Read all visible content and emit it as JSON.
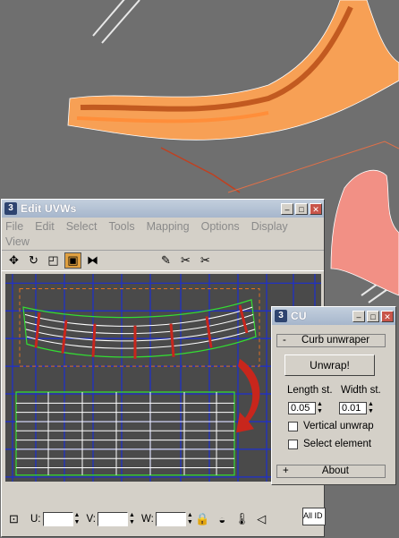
{
  "edit_uvws": {
    "title": "Edit UVWs",
    "menu": [
      "File",
      "Edit",
      "Select",
      "Tools",
      "Mapping",
      "Options",
      "Display",
      "View"
    ],
    "status": {
      "u_label": "U:",
      "v_label": "V:",
      "w_label": "W:",
      "u_value": "",
      "v_value": "",
      "w_value": "",
      "all_ids_label": "All ID"
    }
  },
  "cu_panel": {
    "title": "CU",
    "rollout_curb": "Curb unwraper",
    "rollout_curb_toggle": "-",
    "unwrap_button": "Unwrap!",
    "length_label": "Length st.",
    "width_label": "Width st.",
    "length_value": "0.05",
    "width_value": "0.01",
    "vertical_unwrap_label": "Vertical unwrap",
    "select_element_label": "Select element",
    "rollout_about": "About",
    "rollout_about_toggle": "+"
  },
  "colors": {
    "viewport_bg": "#6f6f6f",
    "curb_orange": "#f08a3a",
    "uv_grid_blue": "#1d2fd0",
    "selection_orange": "#e07020",
    "mesh_green": "#33dd33"
  }
}
